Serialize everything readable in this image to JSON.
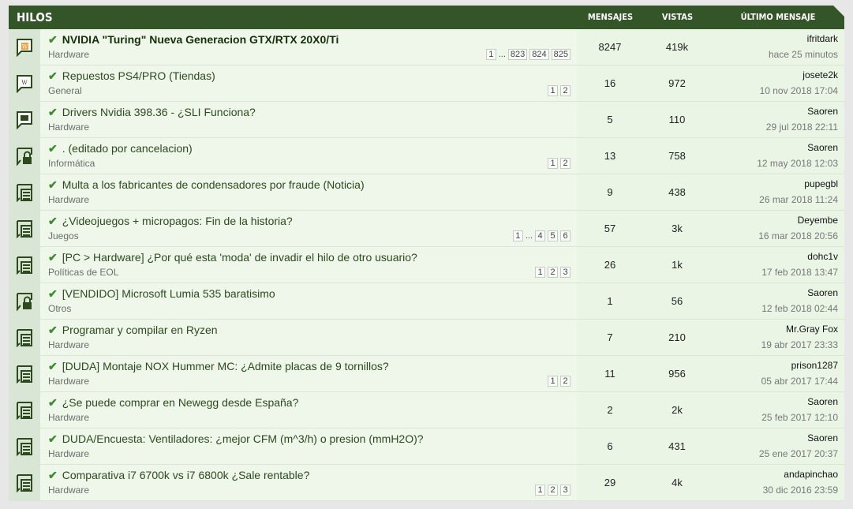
{
  "header": {
    "title": "HILOS",
    "col_messages": "MENSAJES",
    "col_views": "VISTAS",
    "col_last": "ÚLTIMO MENSAJE"
  },
  "threads": [
    {
      "title": "NVIDIA \"Turing\" Nueva Generacion GTX/RTX 20X0/Ti",
      "forum": "Hardware",
      "pages": [
        "1",
        "...",
        "823",
        "824",
        "825"
      ],
      "messages": "8247",
      "views": "419k",
      "last_user": "ifritdark",
      "last_date": "hace 25 minutos",
      "icon": "chat-new-icon",
      "bold": true
    },
    {
      "title": "Repuestos PS4/PRO (Tiendas)",
      "forum": "General",
      "pages": [
        "1",
        "2"
      ],
      "messages": "16",
      "views": "972",
      "last_user": "josete2k",
      "last_date": "10 nov 2018 17:04",
      "icon": "chat-icon",
      "bold": false
    },
    {
      "title": "Drivers Nvidia 398.36 - ¿SLI Funciona?",
      "forum": "Hardware",
      "pages": [],
      "messages": "5",
      "views": "110",
      "last_user": "Saoren",
      "last_date": "29 jul 2018 22:11",
      "icon": "chat-icon",
      "bold": false
    },
    {
      "title": ". (editado por cancelacion)",
      "forum": "Informática",
      "pages": [
        "1",
        "2"
      ],
      "messages": "13",
      "views": "758",
      "last_user": "Saoren",
      "last_date": "12 may 2018 12:03",
      "icon": "lock-icon",
      "bold": false
    },
    {
      "title": "Multa a los fabricantes de condensadores por fraude (Noticia)",
      "forum": "Hardware",
      "pages": [],
      "messages": "9",
      "views": "438",
      "last_user": "pupegbl",
      "last_date": "26 mar 2018 11:24",
      "icon": "archive-icon",
      "bold": false
    },
    {
      "title": "¿Videojuegos + micropagos: Fin de la historia?",
      "forum": "Juegos",
      "pages": [
        "1",
        "...",
        "4",
        "5",
        "6"
      ],
      "messages": "57",
      "views": "3k",
      "last_user": "Deyembe",
      "last_date": "16 mar 2018 20:56",
      "icon": "archive-icon",
      "bold": false
    },
    {
      "title": "[PC > Hardware] ¿Por qué esta 'moda' de invadir el hilo de otro usuario?",
      "forum": "Políticas de EOL",
      "pages": [
        "1",
        "2",
        "3"
      ],
      "messages": "26",
      "views": "1k",
      "last_user": "dohc1v",
      "last_date": "17 feb 2018 13:47",
      "icon": "archive-icon",
      "bold": false
    },
    {
      "title": "[VENDIDO] Microsoft Lumia 535 baratisimo",
      "forum": "Otros",
      "pages": [],
      "messages": "1",
      "views": "56",
      "last_user": "Saoren",
      "last_date": "12 feb 2018 02:44",
      "icon": "lock-icon",
      "bold": false
    },
    {
      "title": "Programar y compilar en Ryzen",
      "forum": "Hardware",
      "pages": [],
      "messages": "7",
      "views": "210",
      "last_user": "Mr.Gray Fox",
      "last_date": "19 abr 2017 23:33",
      "icon": "archive-icon",
      "bold": false
    },
    {
      "title": "[DUDA] Montaje NOX Hummer MC: ¿Admite placas de 9 tornillos?",
      "forum": "Hardware",
      "pages": [
        "1",
        "2"
      ],
      "messages": "11",
      "views": "956",
      "last_user": "prison1287",
      "last_date": "05 abr 2017 17:44",
      "icon": "archive-icon",
      "bold": false
    },
    {
      "title": "¿Se puede comprar en Newegg desde España?",
      "forum": "Hardware",
      "pages": [],
      "messages": "2",
      "views": "2k",
      "last_user": "Saoren",
      "last_date": "25 feb 2017 12:10",
      "icon": "archive-icon",
      "bold": false
    },
    {
      "title": "DUDA/Encuesta: Ventiladores: ¿mejor CFM (m^3/h) o presion (mmH2O)?",
      "forum": "Hardware",
      "pages": [],
      "messages": "6",
      "views": "431",
      "last_user": "Saoren",
      "last_date": "25 ene 2017 20:37",
      "icon": "archive-icon",
      "bold": false
    },
    {
      "title": "Comparativa i7 6700k vs i7 6800k ¿Sale rentable?",
      "forum": "Hardware",
      "pages": [
        "1",
        "2",
        "3"
      ],
      "messages": "29",
      "views": "4k",
      "last_user": "andapinchao",
      "last_date": "30 dic 2016 23:59",
      "icon": "archive-icon",
      "bold": false
    }
  ]
}
